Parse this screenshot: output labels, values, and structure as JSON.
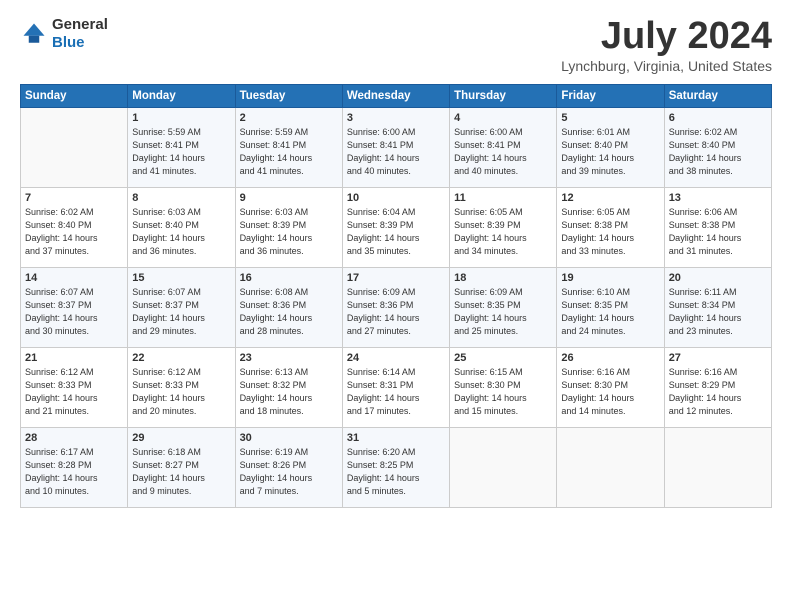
{
  "header": {
    "logo_line1": "General",
    "logo_line2": "Blue",
    "month": "July 2024",
    "location": "Lynchburg, Virginia, United States"
  },
  "days_of_week": [
    "Sunday",
    "Monday",
    "Tuesday",
    "Wednesday",
    "Thursday",
    "Friday",
    "Saturday"
  ],
  "weeks": [
    [
      {
        "day": "",
        "info": ""
      },
      {
        "day": "1",
        "info": "Sunrise: 5:59 AM\nSunset: 8:41 PM\nDaylight: 14 hours\nand 41 minutes."
      },
      {
        "day": "2",
        "info": "Sunrise: 5:59 AM\nSunset: 8:41 PM\nDaylight: 14 hours\nand 41 minutes."
      },
      {
        "day": "3",
        "info": "Sunrise: 6:00 AM\nSunset: 8:41 PM\nDaylight: 14 hours\nand 40 minutes."
      },
      {
        "day": "4",
        "info": "Sunrise: 6:00 AM\nSunset: 8:41 PM\nDaylight: 14 hours\nand 40 minutes."
      },
      {
        "day": "5",
        "info": "Sunrise: 6:01 AM\nSunset: 8:40 PM\nDaylight: 14 hours\nand 39 minutes."
      },
      {
        "day": "6",
        "info": "Sunrise: 6:02 AM\nSunset: 8:40 PM\nDaylight: 14 hours\nand 38 minutes."
      }
    ],
    [
      {
        "day": "7",
        "info": "Sunrise: 6:02 AM\nSunset: 8:40 PM\nDaylight: 14 hours\nand 37 minutes."
      },
      {
        "day": "8",
        "info": "Sunrise: 6:03 AM\nSunset: 8:40 PM\nDaylight: 14 hours\nand 36 minutes."
      },
      {
        "day": "9",
        "info": "Sunrise: 6:03 AM\nSunset: 8:39 PM\nDaylight: 14 hours\nand 36 minutes."
      },
      {
        "day": "10",
        "info": "Sunrise: 6:04 AM\nSunset: 8:39 PM\nDaylight: 14 hours\nand 35 minutes."
      },
      {
        "day": "11",
        "info": "Sunrise: 6:05 AM\nSunset: 8:39 PM\nDaylight: 14 hours\nand 34 minutes."
      },
      {
        "day": "12",
        "info": "Sunrise: 6:05 AM\nSunset: 8:38 PM\nDaylight: 14 hours\nand 33 minutes."
      },
      {
        "day": "13",
        "info": "Sunrise: 6:06 AM\nSunset: 8:38 PM\nDaylight: 14 hours\nand 31 minutes."
      }
    ],
    [
      {
        "day": "14",
        "info": "Sunrise: 6:07 AM\nSunset: 8:37 PM\nDaylight: 14 hours\nand 30 minutes."
      },
      {
        "day": "15",
        "info": "Sunrise: 6:07 AM\nSunset: 8:37 PM\nDaylight: 14 hours\nand 29 minutes."
      },
      {
        "day": "16",
        "info": "Sunrise: 6:08 AM\nSunset: 8:36 PM\nDaylight: 14 hours\nand 28 minutes."
      },
      {
        "day": "17",
        "info": "Sunrise: 6:09 AM\nSunset: 8:36 PM\nDaylight: 14 hours\nand 27 minutes."
      },
      {
        "day": "18",
        "info": "Sunrise: 6:09 AM\nSunset: 8:35 PM\nDaylight: 14 hours\nand 25 minutes."
      },
      {
        "day": "19",
        "info": "Sunrise: 6:10 AM\nSunset: 8:35 PM\nDaylight: 14 hours\nand 24 minutes."
      },
      {
        "day": "20",
        "info": "Sunrise: 6:11 AM\nSunset: 8:34 PM\nDaylight: 14 hours\nand 23 minutes."
      }
    ],
    [
      {
        "day": "21",
        "info": "Sunrise: 6:12 AM\nSunset: 8:33 PM\nDaylight: 14 hours\nand 21 minutes."
      },
      {
        "day": "22",
        "info": "Sunrise: 6:12 AM\nSunset: 8:33 PM\nDaylight: 14 hours\nand 20 minutes."
      },
      {
        "day": "23",
        "info": "Sunrise: 6:13 AM\nSunset: 8:32 PM\nDaylight: 14 hours\nand 18 minutes."
      },
      {
        "day": "24",
        "info": "Sunrise: 6:14 AM\nSunset: 8:31 PM\nDaylight: 14 hours\nand 17 minutes."
      },
      {
        "day": "25",
        "info": "Sunrise: 6:15 AM\nSunset: 8:30 PM\nDaylight: 14 hours\nand 15 minutes."
      },
      {
        "day": "26",
        "info": "Sunrise: 6:16 AM\nSunset: 8:30 PM\nDaylight: 14 hours\nand 14 minutes."
      },
      {
        "day": "27",
        "info": "Sunrise: 6:16 AM\nSunset: 8:29 PM\nDaylight: 14 hours\nand 12 minutes."
      }
    ],
    [
      {
        "day": "28",
        "info": "Sunrise: 6:17 AM\nSunset: 8:28 PM\nDaylight: 14 hours\nand 10 minutes."
      },
      {
        "day": "29",
        "info": "Sunrise: 6:18 AM\nSunset: 8:27 PM\nDaylight: 14 hours\nand 9 minutes."
      },
      {
        "day": "30",
        "info": "Sunrise: 6:19 AM\nSunset: 8:26 PM\nDaylight: 14 hours\nand 7 minutes."
      },
      {
        "day": "31",
        "info": "Sunrise: 6:20 AM\nSunset: 8:25 PM\nDaylight: 14 hours\nand 5 minutes."
      },
      {
        "day": "",
        "info": ""
      },
      {
        "day": "",
        "info": ""
      },
      {
        "day": "",
        "info": ""
      }
    ]
  ]
}
